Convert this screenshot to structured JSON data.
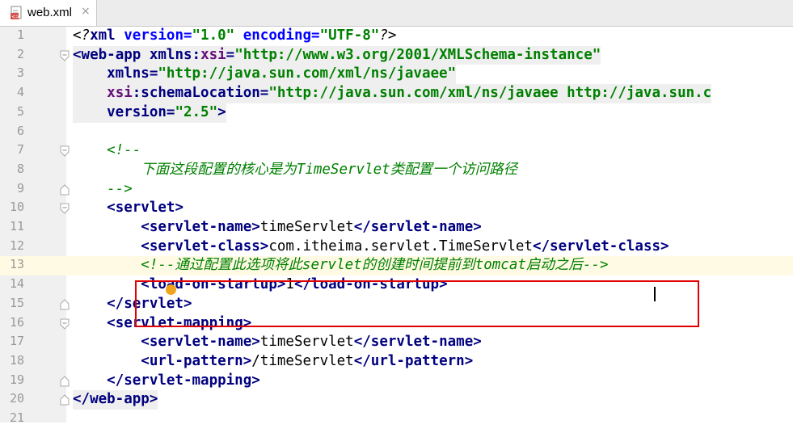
{
  "tab": {
    "title": "web.xml",
    "close": "×"
  },
  "lines": [
    {
      "num": "1"
    },
    {
      "num": "2"
    },
    {
      "num": "3"
    },
    {
      "num": "4"
    },
    {
      "num": "5"
    },
    {
      "num": "6"
    },
    {
      "num": "7"
    },
    {
      "num": "8"
    },
    {
      "num": "9"
    },
    {
      "num": "10"
    },
    {
      "num": "11"
    },
    {
      "num": "12"
    },
    {
      "num": "13"
    },
    {
      "num": "14"
    },
    {
      "num": "15"
    },
    {
      "num": "16"
    },
    {
      "num": "17"
    },
    {
      "num": "18"
    },
    {
      "num": "19"
    },
    {
      "num": "20"
    },
    {
      "num": "21"
    }
  ],
  "code": {
    "l1_a": "<?",
    "l1_b": "xml",
    "l1_c": " version=",
    "l1_d": "\"1.0\"",
    "l1_e": " encoding=",
    "l1_f": "\"UTF-8\"",
    "l1_g": "?>",
    "l2_a": "<",
    "l2_b": "web-app ",
    "l2_c": "xmlns:",
    "l2_d": "xsi",
    "l2_e": "=",
    "l2_f": "\"http://www.w3.org/2001/XMLSchema-instance\"",
    "l3_a": "    xmlns=",
    "l3_b": "\"http://java.sun.com/xml/ns/javaee\"",
    "l4_a": "    ",
    "l4_b": "xsi",
    "l4_c": ":schemaLocation=",
    "l4_d": "\"http://java.sun.com/xml/ns/javaee http://java.sun.c",
    "l5_a": "    version=",
    "l5_b": "\"2.5\"",
    "l5_c": ">",
    "l7": "    <!--",
    "l8": "        下面这段配置的核心是为TimeServlet类配置一个访问路径",
    "l9": "    -->",
    "l10_a": "    <",
    "l10_b": "servlet",
    "l10_c": ">",
    "l11_a": "        <",
    "l11_b": "servlet-name",
    "l11_c": ">",
    "l11_d": "timeServlet",
    "l11_e": "</",
    "l11_f": "servlet-name",
    "l11_g": ">",
    "l12_a": "        <",
    "l12_b": "servlet-class",
    "l12_c": ">",
    "l12_d": "com.itheima.servlet.TimeServlet",
    "l12_e": "</",
    "l12_f": "servlet-class",
    "l12_g": ">",
    "l13": "        <!--通过配置此选项将此servlet的创建时间提前到tomcat启动之后-->",
    "l14_a": "        <",
    "l14_b": "load-on-startup",
    "l14_c": ">",
    "l14_d": "1",
    "l14_e": "</",
    "l14_f": "load-on-startup",
    "l14_g": ">",
    "l15_a": "    </",
    "l15_b": "servlet",
    "l15_c": ">",
    "l16_a": "    <",
    "l16_b": "servlet-mapping",
    "l16_c": ">",
    "l17_a": "        <",
    "l17_b": "servlet-name",
    "l17_c": ">",
    "l17_d": "timeServlet",
    "l17_e": "</",
    "l17_f": "servlet-name",
    "l17_g": ">",
    "l18_a": "        <",
    "l18_b": "url-pattern",
    "l18_c": ">",
    "l18_d": "/timeServlet",
    "l18_e": "</",
    "l18_f": "url-pattern",
    "l18_g": ">",
    "l19_a": "    </",
    "l19_b": "servlet-mapping",
    "l19_c": ">",
    "l20_a": "</",
    "l20_b": "web-app",
    "l20_c": ">"
  },
  "colors": {
    "tag": "#000080",
    "string": "#008000",
    "comment": "#008000",
    "highlight_box": "#e00000"
  }
}
